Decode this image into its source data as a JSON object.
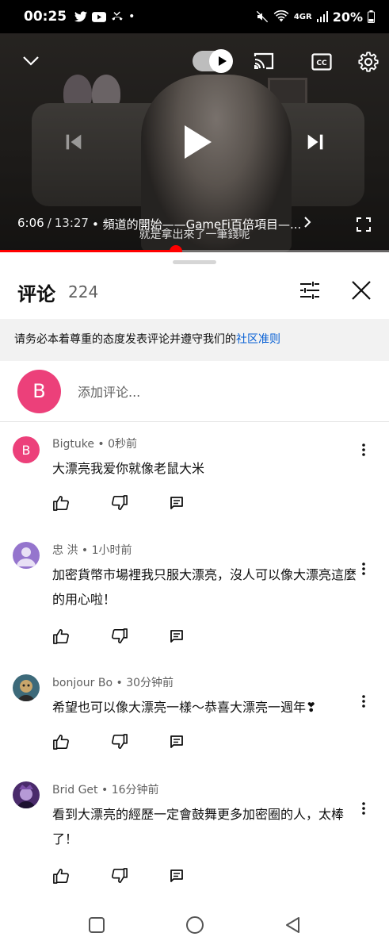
{
  "status_bar": {
    "time": "00:25",
    "notification_icons": [
      "twitter-icon",
      "youtube-icon",
      "missed-call-icon",
      "dot-icon"
    ],
    "network_label": "4GR",
    "battery_percent": "20%"
  },
  "player": {
    "current_time": "6:06",
    "separator": "/",
    "total_time": "13:27",
    "chapter": "• 頻道的開始——GameFi百倍項目—...",
    "subtitle": "就是拿出來了一筆錢呢",
    "progress": 0.453,
    "autoplay_on": true
  },
  "comments_panel": {
    "title": "评论",
    "count": "224",
    "notice_text": "请务必本着尊重的态度发表评论并遵守我们的",
    "notice_link": "社区准则",
    "user_initial": "B",
    "add_comment_placeholder": "添加评论..."
  },
  "comments": [
    {
      "avatar_initial": "B",
      "avatar_color": "#ec407a",
      "author": "Bigtuke",
      "time": "0秒前",
      "text": "大漂亮我爱你就像老鼠大米"
    },
    {
      "avatar_initial": "",
      "avatar_color": "#9575cd",
      "author": "忠 洪",
      "time": "1小时前",
      "text": "加密貨幣市場裡我只服大漂亮，沒人可以像大漂亮這麼的用心啦！"
    },
    {
      "avatar_initial": "",
      "avatar_color": "#3d6a7a",
      "author": "bonjour Bo",
      "time": "30分钟前",
      "text": "希望也可以像大漂亮一樣～恭喜大漂亮一週年❣"
    },
    {
      "avatar_initial": "",
      "avatar_color": "#4a2b6b",
      "author": "Brid Get",
      "time": "16分钟前",
      "text": "看到大漂亮的經歷一定會鼓舞更多加密圈的人，太棒了！"
    }
  ],
  "colors": {
    "accent_red": "#ff0000",
    "link_blue": "#065fd4",
    "user_avatar_pink": "#ec407a"
  }
}
